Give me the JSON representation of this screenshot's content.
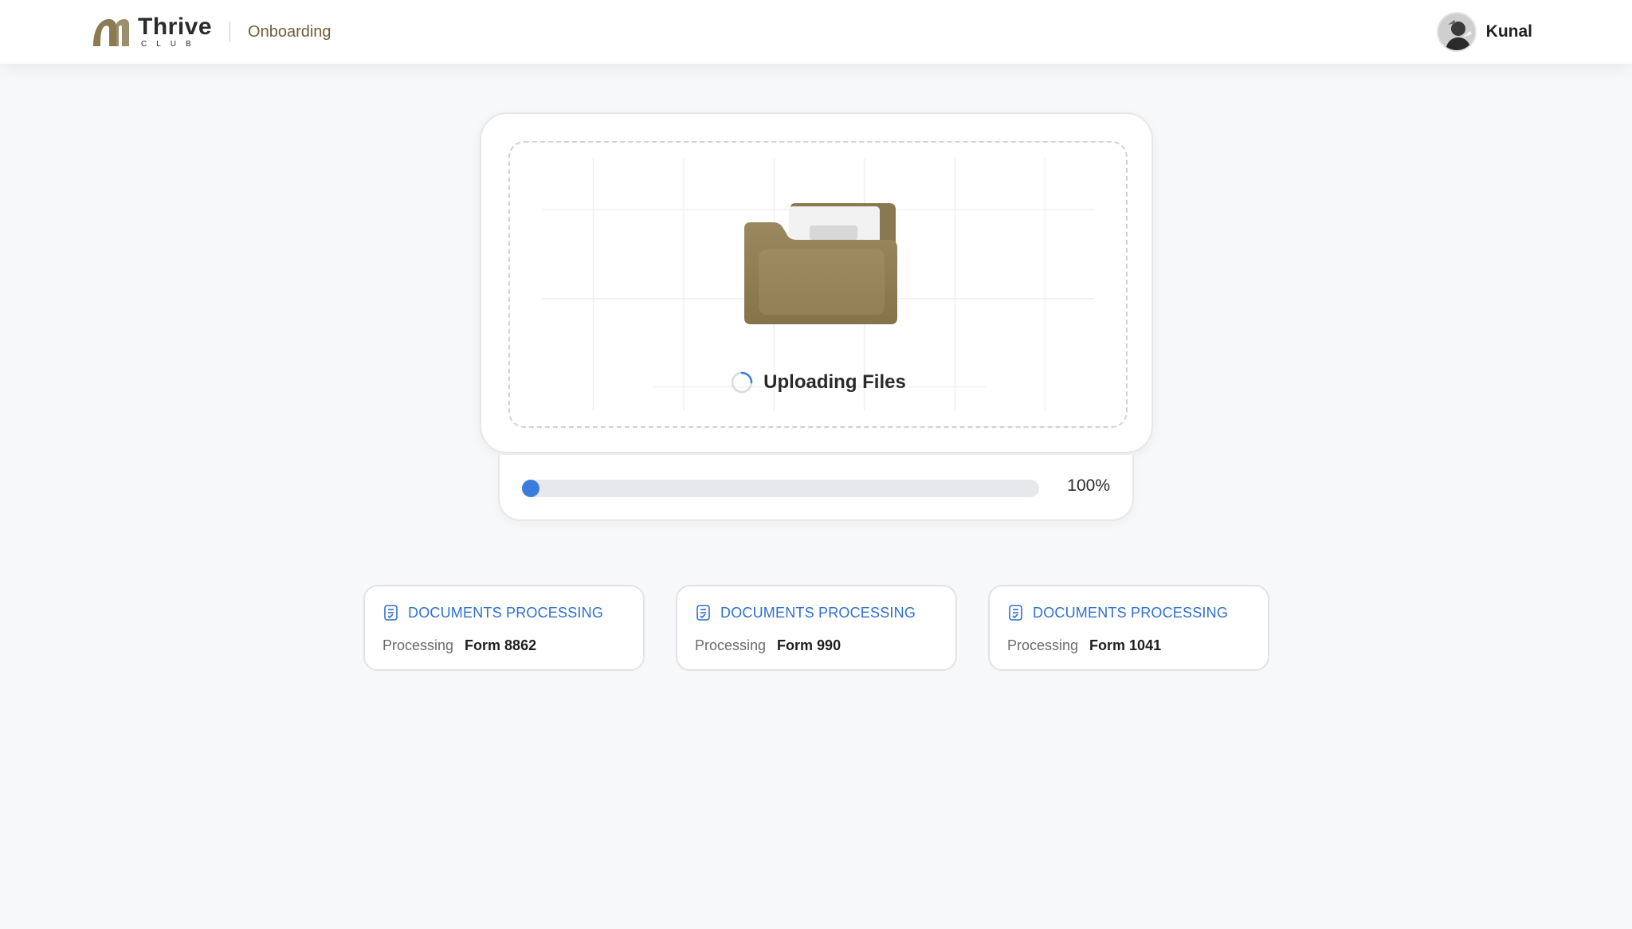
{
  "header": {
    "brand": {
      "title": "Thrive",
      "subtitle": "CLUB"
    },
    "section": "Onboarding",
    "user": {
      "name": "Kunal"
    }
  },
  "upload": {
    "status": "Uploading Files",
    "progress_percent": 100,
    "progress_label": "100%"
  },
  "processing": [
    {
      "title": "DOCUMENTS PROCESSING",
      "label": "Processing",
      "form": "Form 8862"
    },
    {
      "title": "DOCUMENTS PROCESSING",
      "label": "Processing",
      "form": "Form 990"
    },
    {
      "title": "DOCUMENTS PROCESSING",
      "label": "Processing",
      "form": "Form 1041"
    }
  ],
  "colors": {
    "accent": "#3b7ddd",
    "brand": "#8c7a52",
    "processing_title": "#2f6fd1"
  },
  "icons": {
    "logo": "thrive-logo-icon",
    "avatar": "avatar",
    "folder": "folder-icon",
    "spinner": "spinner-icon",
    "document": "document-icon"
  }
}
